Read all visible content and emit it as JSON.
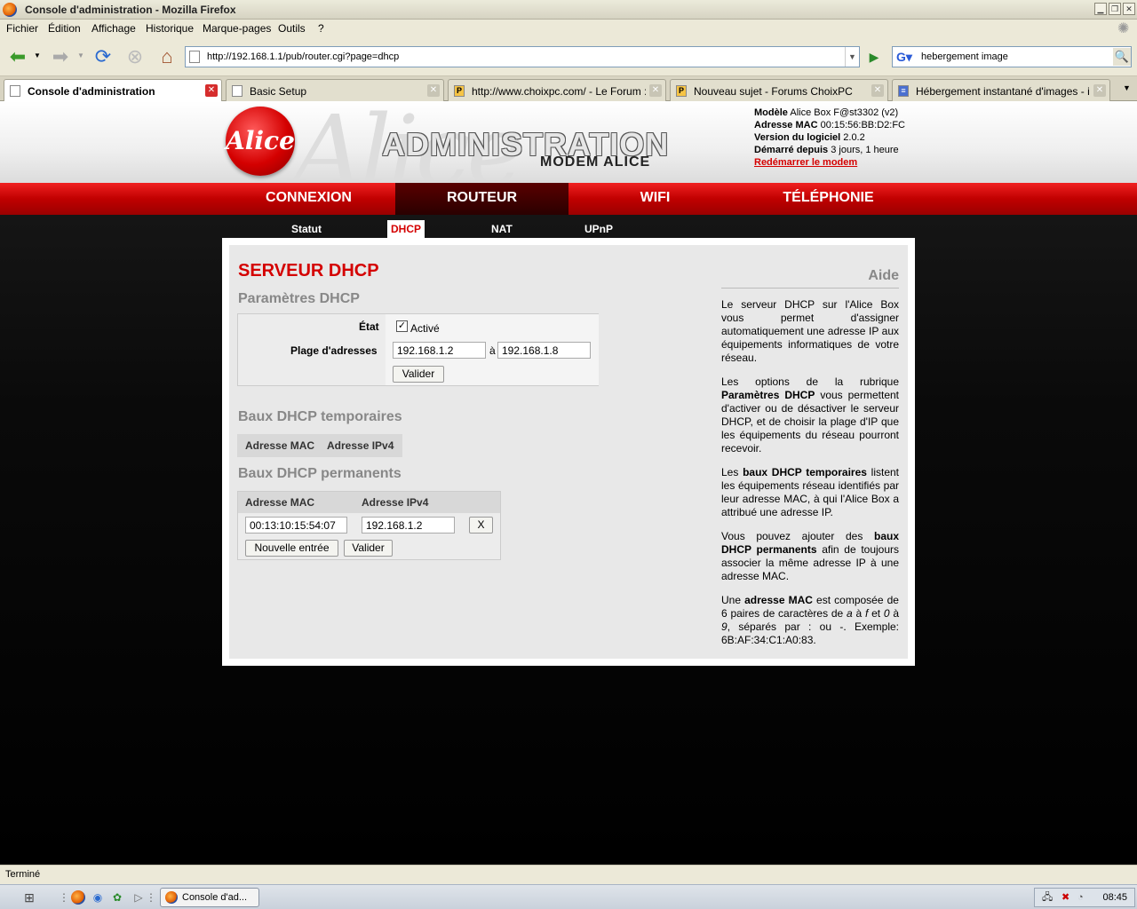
{
  "window": {
    "title": "Console d'administration - Mozilla Firefox"
  },
  "menu": {
    "items": [
      "Fichier",
      "Édition",
      "Affichage",
      "Historique",
      "Marque-pages",
      "Outils",
      "?"
    ]
  },
  "navbar": {
    "url": "http://192.168.1.1/pub/router.cgi?page=dhcp",
    "search_value": "hebergement image"
  },
  "tabs": [
    {
      "label": "Console d'administration",
      "icon": "page-icon",
      "active": true
    },
    {
      "label": "Basic Setup",
      "icon": "page-icon",
      "active": false
    },
    {
      "label": "http://www.choixpc.com/ - Le Forum :...",
      "icon": "p-icon",
      "active": false
    },
    {
      "label": "Nouveau sujet - Forums ChoixPC",
      "icon": "p-icon",
      "active": false
    },
    {
      "label": "Hébergement instantané d'images - im...",
      "icon": "site-icon",
      "active": false
    }
  ],
  "header": {
    "logo_text": "Alice",
    "title": "ADMINISTRATION",
    "subtitle": "MODEM ALICE",
    "info": {
      "model_label": "Modèle",
      "model_value": "Alice Box F@st3302 (v2)",
      "mac_label": "Adresse MAC",
      "mac_value": "00:15:56:BB:D2:FC",
      "version_label": "Version du logiciel",
      "version_value": "2.0.2",
      "uptime_label": "Démarré depuis",
      "uptime_value": "3 jours, 1 heure",
      "restart_link": "Redémarrer le modem"
    }
  },
  "mainnav": [
    "CONNEXION",
    "ROUTEUR",
    "WIFI",
    "TÉLÉPHONIE"
  ],
  "subnav": [
    "Statut",
    "DHCP",
    "NAT",
    "UPnP"
  ],
  "content": {
    "page_title": "SERVEUR DHCP",
    "params": {
      "heading": "Paramètres DHCP",
      "state_label": "État",
      "state_checkbox_label": "Activé",
      "state_checked": true,
      "range_label": "Plage d'adresses",
      "range_start": "192.168.1.2",
      "range_sep": "à",
      "range_end": "192.168.1.8",
      "submit": "Valider"
    },
    "temp_leases": {
      "heading": "Baux DHCP temporaires",
      "col_mac": "Adresse MAC",
      "col_ip": "Adresse IPv4"
    },
    "perm_leases": {
      "heading": "Baux DHCP permanents",
      "col_mac": "Adresse MAC",
      "col_ip": "Adresse IPv4",
      "rows": [
        {
          "mac": "00:13:10:15:54:07",
          "ip": "192.168.1.2",
          "delete": "X"
        }
      ],
      "new_entry": "Nouvelle entrée",
      "submit": "Valider"
    }
  },
  "help": {
    "title": "Aide",
    "p1": "Le serveur DHCP sur l'Alice Box vous permet d'assigner automatiquement une adresse IP aux équipements informatiques de votre réseau.",
    "p2a": "Les options de la rubrique ",
    "p2b": "Paramètres DHCP",
    "p2c": " vous permettent d'activer ou de désactiver le serveur DHCP, et de choisir la plage d'IP que les équipements du réseau pourront recevoir.",
    "p3a": "Les ",
    "p3b": "baux DHCP temporaires",
    "p3c": " listent les équipements réseau identifiés par leur adresse MAC, à qui l'Alice Box a attribué une adresse IP.",
    "p4a": "Vous pouvez ajouter des ",
    "p4b": "baux DHCP permanents",
    "p4c": " afin de toujours associer la même adresse IP à une adresse MAC.",
    "p5a": "Une ",
    "p5b": "adresse MAC",
    "p5c": " est composée de 6 paires de caractères de ",
    "p5d": "a",
    "p5e": " à ",
    "p5f": "f",
    "p5g": " et ",
    "p5h": "0",
    "p5i": " à ",
    "p5j": "9",
    "p5k": ", séparés par : ou -. Exemple: 6B:AF:34:C1:A0:83."
  },
  "status": {
    "text": "Terminé"
  },
  "taskbar": {
    "task_label": "Console d'ad...",
    "clock": "08:45"
  }
}
